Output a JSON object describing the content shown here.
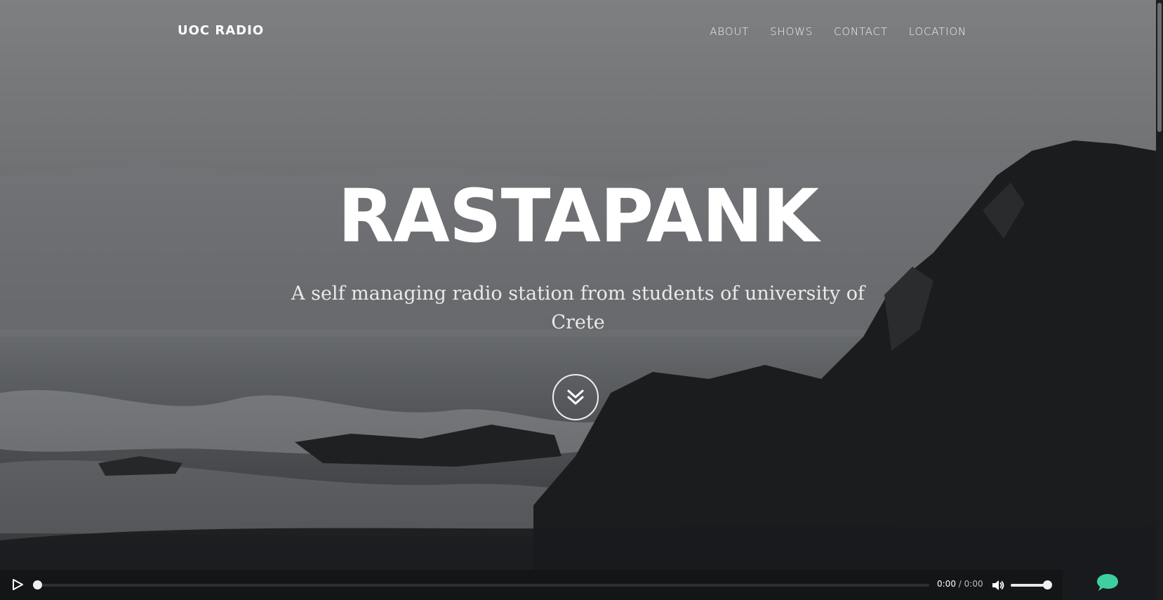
{
  "nav": {
    "brand": "UOC RADIO",
    "items": [
      {
        "label": "ABOUT"
      },
      {
        "label": "SHOWS"
      },
      {
        "label": "CONTACT"
      },
      {
        "label": "LOCATION"
      }
    ]
  },
  "hero": {
    "title": "RASTAPANK",
    "subtitle_line1": "A self managing radio station from students of university of",
    "subtitle_line2": "Crete",
    "scroll_icon": "double-chevron-down-icon"
  },
  "player": {
    "current_time": "0:00",
    "separator": "/",
    "duration": "0:00",
    "progress": 0,
    "volume": 1,
    "play_icon": "play-icon",
    "volume_icon": "speaker-icon"
  },
  "chat": {
    "icon": "chat-bubble-icon",
    "color": "#3ecfa0"
  }
}
